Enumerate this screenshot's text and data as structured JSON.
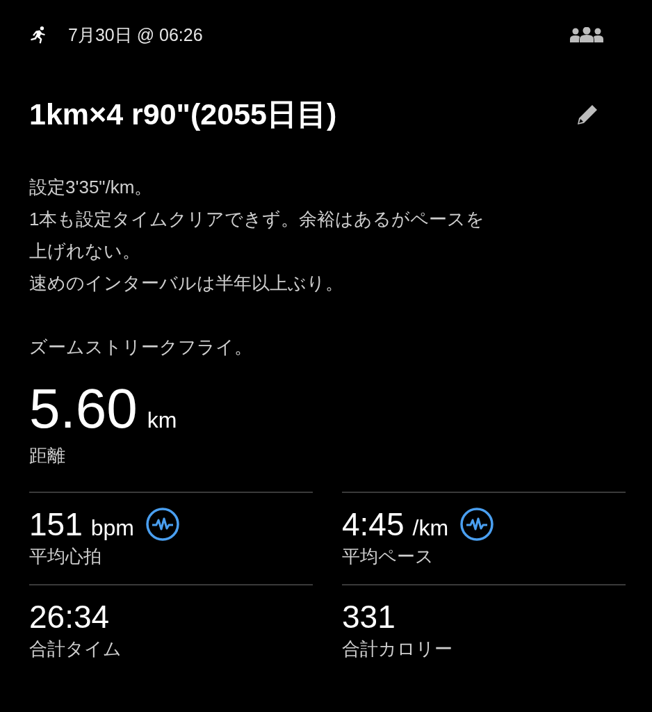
{
  "header": {
    "date": "7月30日 @ 06:26"
  },
  "title": "1km×4 r90\"(2055日目)",
  "description": [
    [
      "設定3'35\"/km。",
      "1本も設定タイムクリアできず。余裕はあるがペースを上げれない。",
      "速めのインターバルは半年以上ぶり。"
    ],
    [
      "ズームストリークフライ。"
    ]
  ],
  "distance": {
    "value": "5.60",
    "unit": "km",
    "label": "距離"
  },
  "stats": [
    {
      "value": "151",
      "unit": "bpm",
      "label": "平均心拍",
      "chart_link": true
    },
    {
      "value": "4:45",
      "unit": "/km",
      "label": "平均ペース",
      "chart_link": true
    },
    {
      "value": "26:34",
      "label": "合計タイム",
      "chart_link": false
    },
    {
      "value": "331",
      "label": "合計カロリー",
      "chart_link": false
    }
  ]
}
